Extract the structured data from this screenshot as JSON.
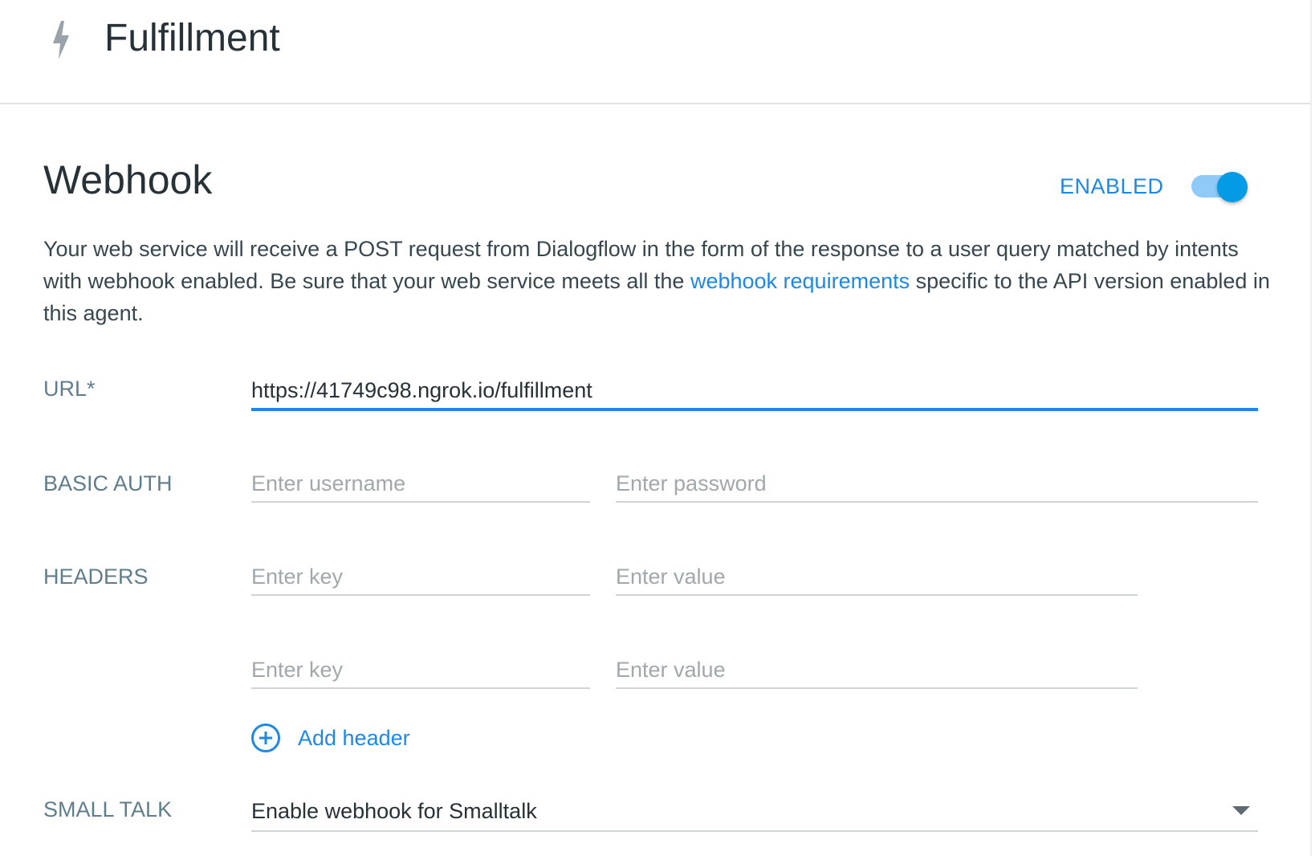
{
  "header": {
    "icon": "bolt-icon",
    "title": "Fulfillment"
  },
  "webhook": {
    "title": "Webhook",
    "enabled_label": "ENABLED",
    "enabled": true,
    "description_before": "Your web service will receive a POST request from Dialogflow in the form of the response to a user query matched by intents with webhook enabled. Be sure that your web service meets all the ",
    "description_link": "webhook requirements",
    "description_after": " specific to the API version enabled in this agent."
  },
  "url": {
    "label": "URL*",
    "value": "https://41749c98.ngrok.io/fulfillment"
  },
  "basic_auth": {
    "label": "BASIC AUTH",
    "username_placeholder": "Enter username",
    "password_placeholder": "Enter password"
  },
  "headers": {
    "label": "HEADERS",
    "rows": [
      {
        "key_placeholder": "Enter key",
        "value_placeholder": "Enter value"
      },
      {
        "key_placeholder": "Enter key",
        "value_placeholder": "Enter value"
      }
    ],
    "add_label": "Add header"
  },
  "small_talk": {
    "label": "SMALL TALK",
    "selected": "Enable webhook for Smalltalk"
  },
  "colors": {
    "accent": "#1e88e5",
    "toggle_knob": "#039be5",
    "toggle_track": "#90caf9"
  }
}
